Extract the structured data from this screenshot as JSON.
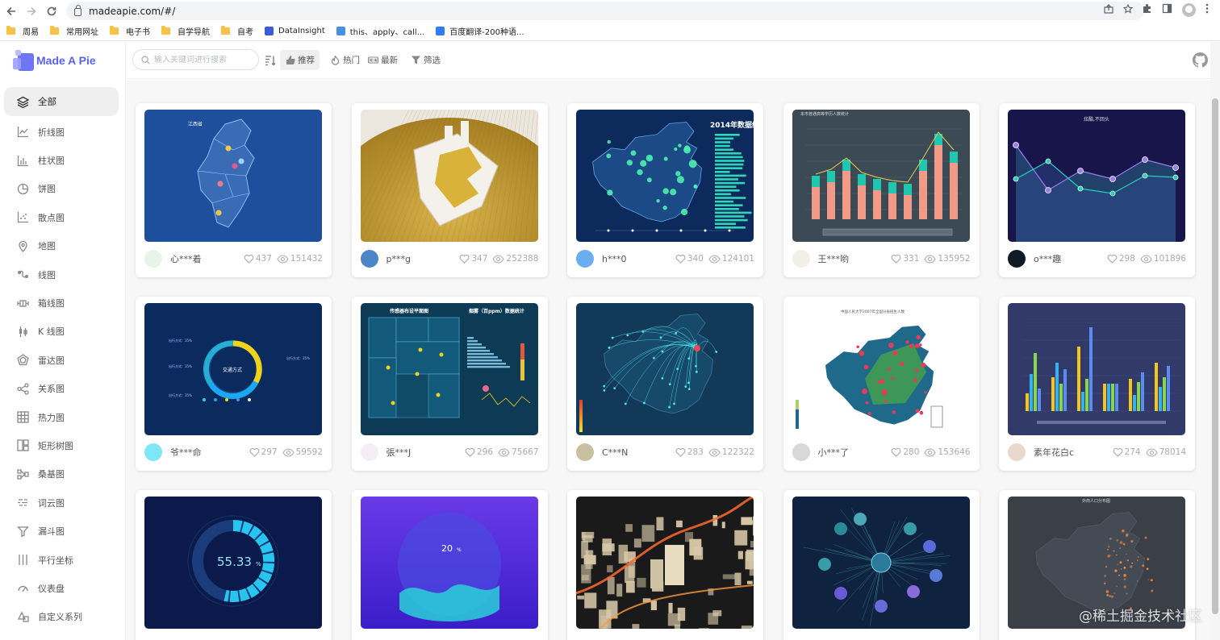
{
  "browser": {
    "url": "madeapie.com/#/",
    "bookmarks": [
      {
        "label": "周易",
        "type": "folder"
      },
      {
        "label": "常用网址",
        "type": "folder"
      },
      {
        "label": "电子书",
        "type": "folder"
      },
      {
        "label": "自学导航",
        "type": "folder"
      },
      {
        "label": "自考",
        "type": "folder"
      },
      {
        "label": "DataInsight",
        "type": "site",
        "color": "#3b5bdb"
      },
      {
        "label": "this、apply、call...",
        "type": "site",
        "color": "#4a90e2"
      },
      {
        "label": "百度翻译-200种语...",
        "type": "site",
        "color": "#2f7cf6"
      }
    ]
  },
  "app": {
    "logo_text": "Made A Pie",
    "search_placeholder": "输入关键词进行搜索",
    "filters": [
      {
        "label": "推荐",
        "icon": "thumbs-up-icon",
        "active": true
      },
      {
        "label": "热门",
        "icon": "fire-icon",
        "active": false
      },
      {
        "label": "最新",
        "icon": "new-icon",
        "active": false
      },
      {
        "label": "筛选",
        "icon": "funnel-icon",
        "active": false
      }
    ],
    "accent": "#5b63e8"
  },
  "sidebar": {
    "items": [
      {
        "label": "全部",
        "icon": "layers-icon",
        "active": true
      },
      {
        "label": "折线图",
        "icon": "line-chart-icon"
      },
      {
        "label": "柱状图",
        "icon": "bar-chart-icon"
      },
      {
        "label": "饼图",
        "icon": "pie-chart-icon"
      },
      {
        "label": "散点图",
        "icon": "scatter-icon"
      },
      {
        "label": "地图",
        "icon": "map-pin-icon"
      },
      {
        "label": "线图",
        "icon": "lines-icon"
      },
      {
        "label": "箱线图",
        "icon": "boxplot-icon"
      },
      {
        "label": "K 线图",
        "icon": "candlestick-icon"
      },
      {
        "label": "雷达图",
        "icon": "radar-icon"
      },
      {
        "label": "关系图",
        "icon": "graph-icon"
      },
      {
        "label": "热力图",
        "icon": "heatmap-icon"
      },
      {
        "label": "矩形树图",
        "icon": "treemap-icon"
      },
      {
        "label": "桑基图",
        "icon": "sankey-icon"
      },
      {
        "label": "词云图",
        "icon": "wordcloud-icon"
      },
      {
        "label": "漏斗图",
        "icon": "funnel-chart-icon"
      },
      {
        "label": "平行坐标",
        "icon": "parallel-icon"
      },
      {
        "label": "仪表盘",
        "icon": "gauge-icon"
      },
      {
        "label": "自定义系列",
        "icon": "custom-icon"
      }
    ]
  },
  "cards": [
    {
      "thumb": "jiangxi-map",
      "bg": "#1e4f9c",
      "user": "心***着",
      "avatar": "#e8f4ea",
      "likes": "437",
      "views": "151432"
    },
    {
      "thumb": "bitcoin",
      "bg": "#d9c89a",
      "user": "p***g",
      "avatar": "#4a86c8",
      "likes": "347",
      "views": "252388"
    },
    {
      "thumb": "china-bubble-bars",
      "bg": "#0c2a5c",
      "user": "h***0",
      "avatar": "#6aaef0",
      "likes": "340",
      "views": "124101"
    },
    {
      "thumb": "stacked-bars",
      "bg": "#3b4a55",
      "user": "王***哟",
      "avatar": "#f2efe6",
      "likes": "331",
      "views": "135952"
    },
    {
      "thumb": "area-lines",
      "bg": "#17154a",
      "user": "o***趣",
      "avatar": "#0e1a24",
      "likes": "298",
      "views": "101896"
    },
    {
      "thumb": "ring-gauge",
      "bg": "#0b2a5e",
      "user": "爷***命",
      "avatar": "#7fe6f6",
      "likes": "297",
      "views": "59592"
    },
    {
      "thumb": "dashboard",
      "bg": "#0d3b55",
      "user": "張***J",
      "avatar": "#f4eef4",
      "likes": "296",
      "views": "75667"
    },
    {
      "thumb": "flight-lines",
      "bg": "#123a58",
      "user": "C***N",
      "avatar": "#c8c0a0",
      "likes": "283",
      "views": "122322"
    },
    {
      "thumb": "china-white",
      "bg": "#ffffff",
      "user": "小***了",
      "avatar": "#d8d8d8",
      "likes": "280",
      "views": "153646"
    },
    {
      "thumb": "multi-bars",
      "bg": "#323a6a",
      "user": "素年花白c",
      "avatar": "#ead8cc",
      "likes": "274",
      "views": "78014"
    },
    {
      "thumb": "percent-ring",
      "bg": "#0b1a4a",
      "text": "55.33",
      "unit": "%"
    },
    {
      "thumb": "liquid",
      "bg": "#5a2ed4",
      "text": "20",
      "unit": "%"
    },
    {
      "thumb": "city-3d",
      "bg": "#1a1a1a"
    },
    {
      "thumb": "tree-graph",
      "bg": "#0f2340"
    },
    {
      "thumb": "china-dark",
      "bg": "#3a3f48"
    }
  ],
  "watermark": "@稀土掘金技术社区"
}
